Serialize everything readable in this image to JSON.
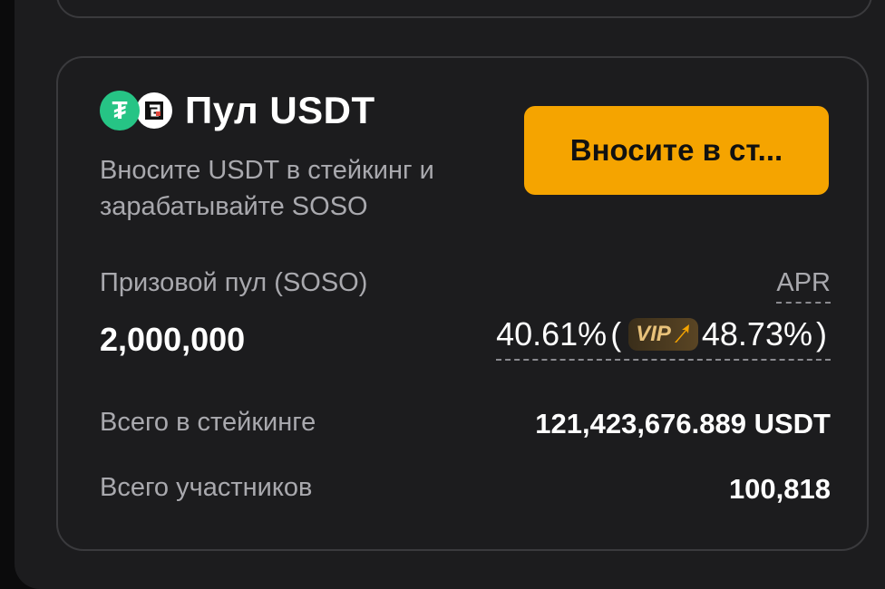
{
  "pool": {
    "title": "Пул USDT",
    "description": "Вносите USDT в стейкинг и зарабатывайте SOSO",
    "stake_button": "Вносите в ст...",
    "icons": [
      "usdt-icon",
      "soso-icon"
    ],
    "usdt_symbol": "₮"
  },
  "prize": {
    "label": "Призовой пул (SOSO)",
    "value": "2,000,000"
  },
  "apr": {
    "label": "APR",
    "base": "40.61%",
    "open_paren": "(",
    "vip_label": "VIP",
    "vip_value": "48.73%",
    "close_paren": ")"
  },
  "stats": {
    "total_staked_label": "Всего в стейкинге",
    "total_staked_value": "121,423,676.889 USDT",
    "participants_label": "Всего участников",
    "participants_value": "100,818"
  },
  "colors": {
    "accent": "#f5a400",
    "usdt_green": "#26c485",
    "card_border": "#3a3a3d",
    "muted_text": "#a9a9ae"
  }
}
